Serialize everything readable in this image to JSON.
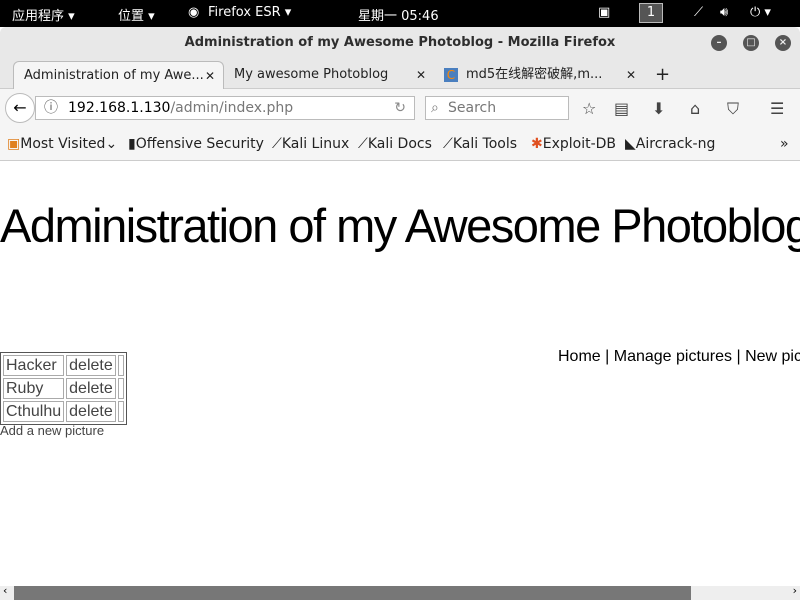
{
  "system_bar": {
    "apps": "应用程序 ▾",
    "places": "位置 ▾",
    "app": "Firefox ESR ▾",
    "clock": "星期一 05:46",
    "workspace": "1"
  },
  "window": {
    "title": "Administration of my Awesome Photoblog - Mozilla Firefox"
  },
  "tabs": [
    {
      "label": "Administration of my Awe..."
    },
    {
      "label": "My awesome Photoblog"
    },
    {
      "label": "md5在线解密破解,m..."
    }
  ],
  "nav": {
    "url_host": "192.168.1.130",
    "url_path": "/admin/index.php",
    "search_placeholder": "Search"
  },
  "bookmarks": [
    "Most Visited",
    "Offensive Security",
    "Kali Linux",
    "Kali Docs",
    "Kali Tools",
    "Exploit-DB",
    "Aircrack-ng"
  ],
  "page": {
    "heading": "Administration of my Awesome Photoblog",
    "menu": [
      "Home",
      "Manage pictures",
      "New picture"
    ],
    "pictures": [
      {
        "name": "Hacker",
        "action": "delete"
      },
      {
        "name": "Ruby",
        "action": "delete"
      },
      {
        "name": "Cthulhu",
        "action": "delete"
      }
    ],
    "add_link": "Add a new picture"
  }
}
